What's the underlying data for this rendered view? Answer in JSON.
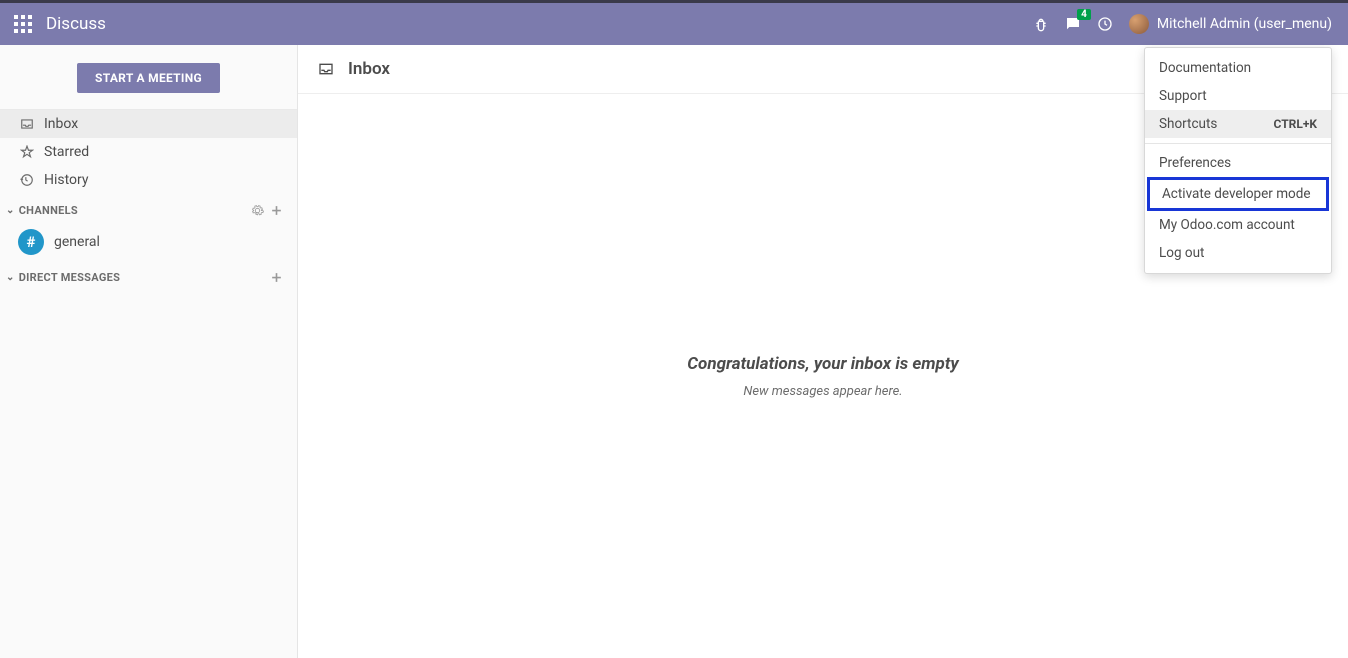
{
  "topbar": {
    "app_title": "Discuss",
    "chat_badge": "4",
    "user_name": "Mitchell Admin (user_menu)"
  },
  "sidebar": {
    "meeting_button": "START A MEETING",
    "nav": [
      {
        "label": "Inbox",
        "icon": "inbox"
      },
      {
        "label": "Starred",
        "icon": "star"
      },
      {
        "label": "History",
        "icon": "history"
      }
    ],
    "channels_header": "CHANNELS",
    "channels": [
      {
        "label": "general"
      }
    ],
    "dm_header": "DIRECT MESSAGES"
  },
  "content": {
    "title": "Inbox",
    "empty_title": "Congratulations, your inbox is empty",
    "empty_sub": "New messages appear here."
  },
  "user_menu": {
    "documentation": "Documentation",
    "support": "Support",
    "shortcuts": "Shortcuts",
    "shortcuts_key": "CTRL+K",
    "preferences": "Preferences",
    "dev_mode": "Activate developer mode",
    "odoo_account": "My Odoo.com account",
    "logout": "Log out"
  }
}
